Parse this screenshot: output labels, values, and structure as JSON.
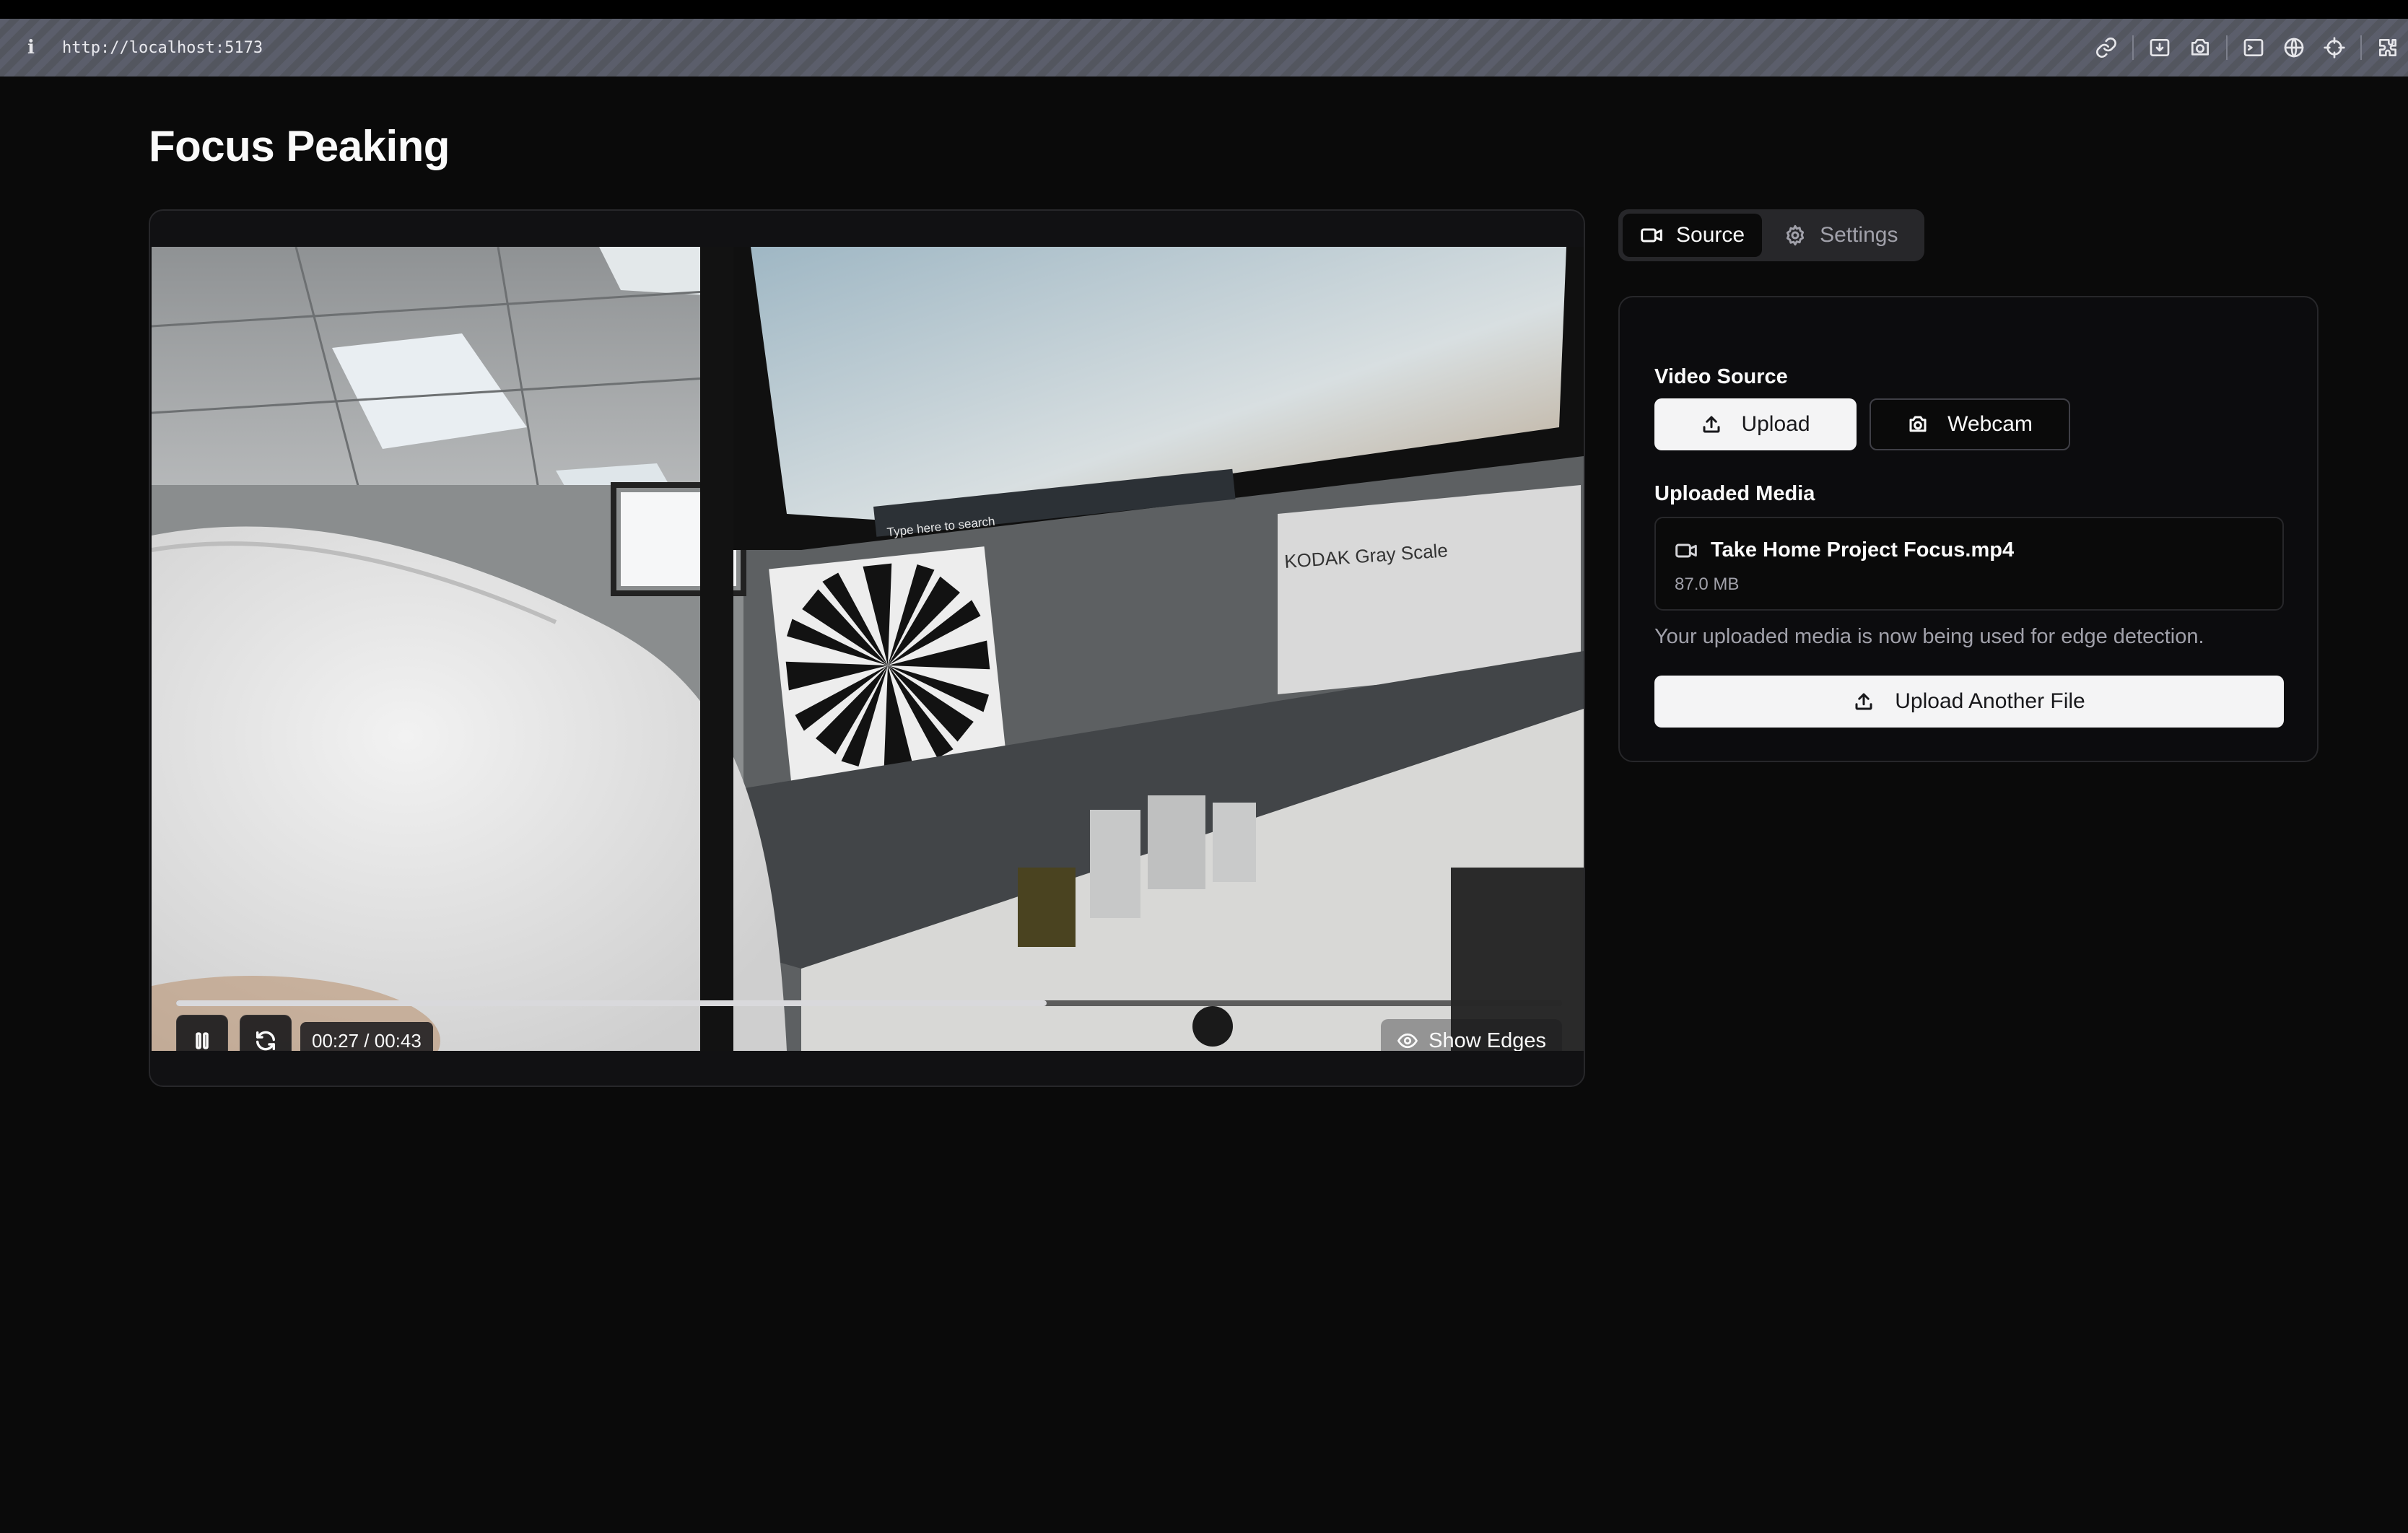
{
  "browser": {
    "info_glyph": "i",
    "url": "http://localhost:5173",
    "toolbar_icons": [
      "link-icon",
      "download-icon",
      "camera-icon",
      "terminal-icon",
      "globe-icon",
      "crosshair-icon",
      "extensions-icon"
    ]
  },
  "page": {
    "title": "Focus Peaking"
  },
  "player": {
    "current_time": "00:27",
    "duration": "00:43",
    "time_display": "00:27 / 00:43",
    "progress": 0.628,
    "buffered": 1.0,
    "show_edges_label": "Show Edges",
    "state": "playing",
    "scene_text": {
      "search_placeholder": "Type here to search",
      "gray_scale_label": "KODAK Gray Scale"
    }
  },
  "tabs": [
    {
      "label": "Source",
      "icon": "video-camera-icon",
      "active": true
    },
    {
      "label": "Settings",
      "icon": "gear-icon",
      "active": false
    }
  ],
  "source_panel": {
    "video_source_label": "Video Source",
    "upload_label": "Upload",
    "webcam_label": "Webcam",
    "uploaded_media_label": "Uploaded Media",
    "file_name": "Take Home Project Focus.mp4",
    "file_size": "87.0 MB",
    "note": "Your uploaded media is now being used for edge detection.",
    "upload_another_label": "Upload Another File"
  },
  "colors": {
    "background": "#0a0a0a",
    "card": "#111113",
    "border": "#27272a",
    "primary_button": "#f4f4f5",
    "muted_text": "#a1a1aa"
  }
}
